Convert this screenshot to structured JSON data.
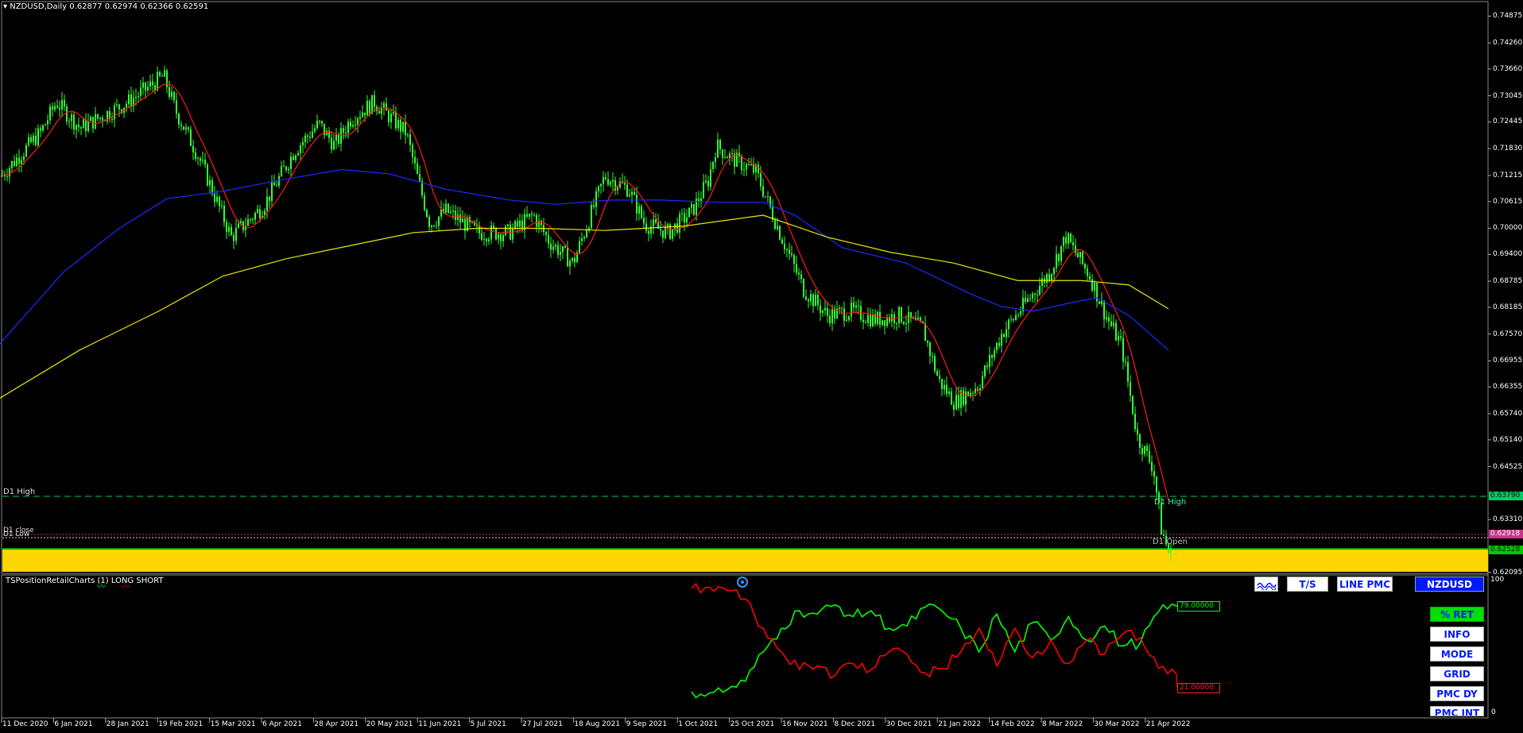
{
  "header": {
    "symbol_line": "NZDUSD,Daily  0.62877 0.62974 0.62366 0.62591"
  },
  "price_axis": {
    "ticks": [
      "0.74875",
      "0.74260",
      "0.73660",
      "0.73045",
      "0.72445",
      "0.71830",
      "0.71215",
      "0.70615",
      "0.70000",
      "0.69400",
      "0.68785",
      "0.68185",
      "0.67570",
      "0.66955",
      "0.66355",
      "0.65740",
      "0.65140",
      "0.64525",
      "0.63310",
      "0.62095"
    ]
  },
  "price_tags": {
    "d1_high": "0.63790",
    "d1_close": "0.62918",
    "current": "0.62528",
    "current_tag_color": "#00cc00",
    "d1_high_tag_color": "#00cc66",
    "d1_close_tag_color": "#cc3388"
  },
  "level_labels": {
    "d1_high_left": "D1 High",
    "d1_close_left": "D1 close",
    "d1_low_left": "D1 Low",
    "d1_high_right": "D1 High",
    "d1_open_right": "D1 Open"
  },
  "indicator": {
    "name": "TSPositionRetailCharts (1) LONG SHORT",
    "long_value": "79.00000",
    "short_value": "21.00000",
    "scale_top": "100",
    "scale_bottom": "0"
  },
  "buttons": {
    "chart_icon": "wave-icon",
    "ts": "T/S",
    "line_pmc": "LINE PMC",
    "symbol": "NZDUSD",
    "ret": "% RET",
    "info": "INFO",
    "mode": "MODE",
    "grid": "GRID",
    "pmc_dy": "PMC DY",
    "pmc_int": "PMC INT"
  },
  "time_axis": {
    "labels": [
      "11 Dec 2020",
      "6 Jan 2021",
      "28 Jan 2021",
      "19 Feb 2021",
      "15 Mar 2021",
      "6 Apr 2021",
      "28 Apr 2021",
      "20 May 2021",
      "11 Jun 2021",
      "5 Jul 2021",
      "27 Jul 2021",
      "18 Aug 2021",
      "9 Sep 2021",
      "1 Oct 2021",
      "25 Oct 2021",
      "16 Nov 2021",
      "8 Dec 2021",
      "30 Dec 2021",
      "21 Jan 2022",
      "14 Feb 2022",
      "8 Mar 2022",
      "30 Mar 2022",
      "21 Apr 2022"
    ]
  },
  "colors": {
    "candle": "#33ff33",
    "ma_fast": "#ff1a1a",
    "ma_mid": "#1a2cff",
    "ma_slow": "#e8e800",
    "band": "#ffd700",
    "long_line": "#00ff00",
    "short_line": "#ff0000",
    "background": "#000000"
  },
  "chart_data": {
    "type": "line",
    "title": "NZDUSD,Daily",
    "series": [
      {
        "name": "LONG",
        "values": [
          6,
          5,
          8,
          15,
          40,
          60,
          75,
          72,
          80,
          70,
          75,
          60,
          62,
          78,
          74,
          60,
          40,
          72,
          40,
          65,
          50,
          70,
          50,
          62,
          45,
          48,
          74,
          79
        ]
      },
      {
        "name": "SHORT",
        "values": [
          94,
          95,
          92,
          85,
          60,
          40,
          25,
          28,
          20,
          30,
          25,
          40,
          38,
          22,
          26,
          40,
          60,
          28,
          60,
          35,
          50,
          30,
          50,
          38,
          55,
          52,
          26,
          21
        ]
      }
    ],
    "ylim": [
      0,
      100
    ]
  }
}
